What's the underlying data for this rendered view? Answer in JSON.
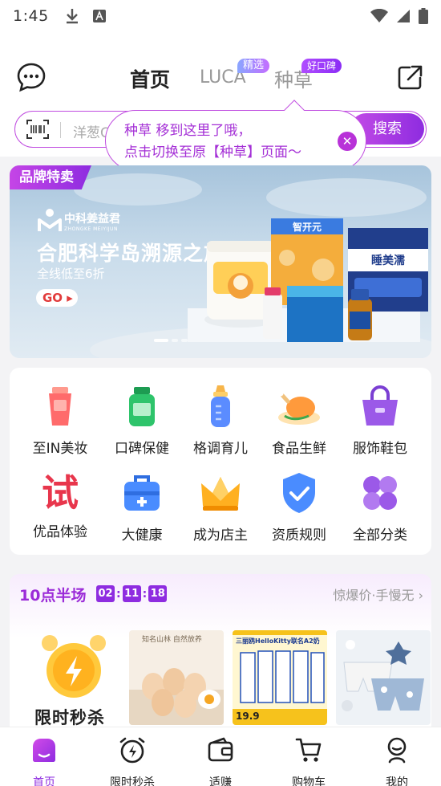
{
  "status_bar": {
    "time": "1:45"
  },
  "header": {
    "tabs": [
      {
        "label": "首页",
        "active": true
      },
      {
        "label": "LUCA",
        "badge": "精选"
      },
      {
        "label": "种草",
        "badge": "好口碑"
      }
    ],
    "search": {
      "placeholder": "洋葱C",
      "button": "搜索"
    }
  },
  "tooltip": {
    "line1": "种草 移到这里了哦，",
    "line2": "点击切换至原【种草】页面～"
  },
  "banner": {
    "tag": "品牌特卖",
    "brand": "中科姜益君",
    "brand_sub": "ZHONGKE MEIYIJUN",
    "title": "合肥科学岛溯源之旅",
    "subtitle": "全线低至6折",
    "go": "GO",
    "product_labels": [
      "智开元",
      "睡美濡"
    ]
  },
  "categories": [
    {
      "label": "至IN美妆",
      "icon": "lotion-tube-icon",
      "color": "#ff6b6b"
    },
    {
      "label": "口碑保健",
      "icon": "supplement-bottle-icon",
      "color": "#2ec46b"
    },
    {
      "label": "格调育儿",
      "icon": "baby-bottle-icon",
      "color": "#5b8cff"
    },
    {
      "label": "食品生鲜",
      "icon": "roast-chicken-icon",
      "color": "#ff9a3c"
    },
    {
      "label": "服饰鞋包",
      "icon": "handbag-icon",
      "color": "#9b59e8"
    },
    {
      "label": "优品体验",
      "icon": "trial-character-icon",
      "color": "#e8364c"
    },
    {
      "label": "大健康",
      "icon": "first-aid-kit-icon",
      "color": "#4a8cff"
    },
    {
      "label": "成为店主",
      "icon": "crown-icon",
      "color": "#ffb020"
    },
    {
      "label": "资质规则",
      "icon": "shield-check-icon",
      "color": "#4a8cff"
    },
    {
      "label": "全部分类",
      "icon": "four-petal-grid-icon",
      "color": "#9b59e8"
    }
  ],
  "trial_char": "试",
  "flash_sale": {
    "title": "10点半场",
    "countdown": {
      "h": "02",
      "m": "11",
      "s": "18"
    },
    "more": "惊爆价·手慢无",
    "promo_label": "限时秒杀",
    "products": [
      {
        "name": "eggs",
        "caption": "知名山林 自然放养"
      },
      {
        "name": "milk",
        "caption": "三丽鸥HelloKitty联名A2奶",
        "price": "19.9"
      },
      {
        "name": "kids-underwear",
        "caption": ""
      }
    ]
  },
  "bottom_nav": [
    {
      "label": "首页",
      "active": true
    },
    {
      "label": "限时秒杀"
    },
    {
      "label": "适赚"
    },
    {
      "label": "购物车"
    },
    {
      "label": "我的"
    }
  ]
}
